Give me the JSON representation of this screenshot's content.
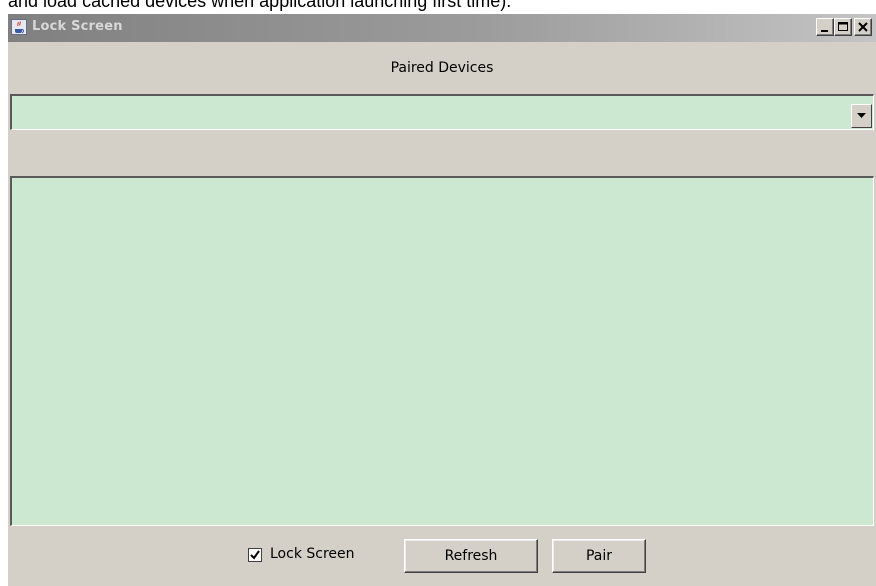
{
  "page_caption": "and load cached devices when application launching first time).",
  "window": {
    "title": "Lock Screen",
    "app_icon": "java-cup-icon",
    "controls": [
      "minimize-icon",
      "maximize-icon",
      "close-icon"
    ]
  },
  "paired_devices": {
    "label": "Paired Devices",
    "selected_value": ""
  },
  "device_list": {
    "items": []
  },
  "footer": {
    "lock_screen_label": "Lock Screen",
    "lock_screen_checked": true,
    "refresh_label": "Refresh",
    "pair_label": "Pair"
  },
  "colors": {
    "field_background": "#cde8d1",
    "window_background": "#d4d0c8",
    "titlebar_inactive": "#808080"
  }
}
